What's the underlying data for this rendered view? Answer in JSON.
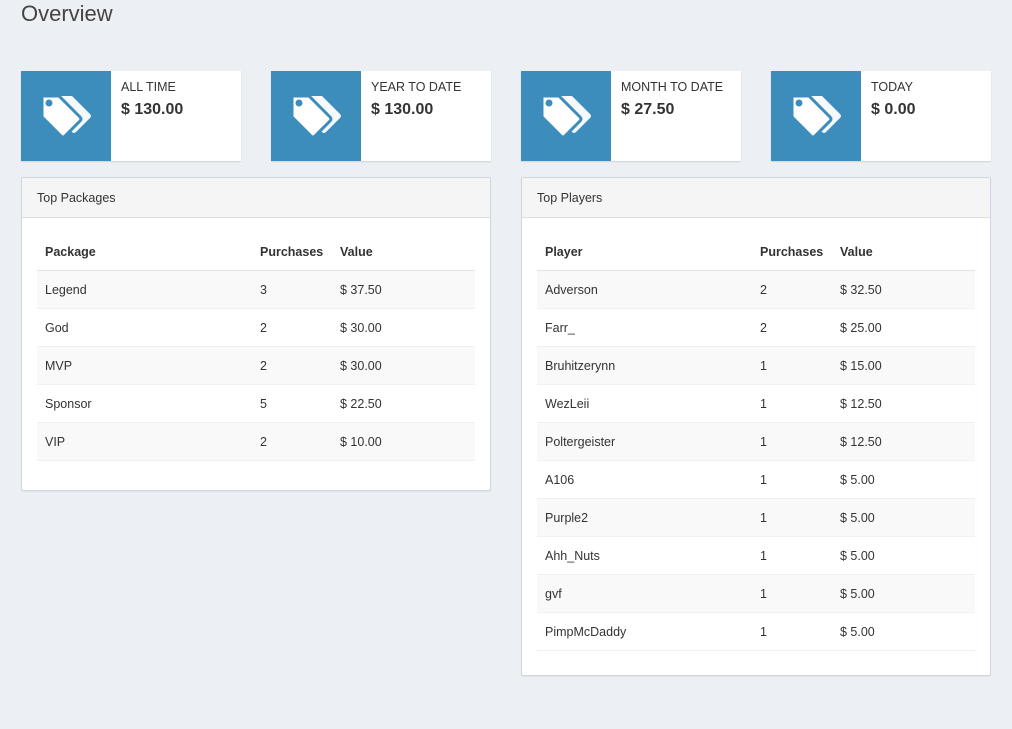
{
  "page": {
    "title": "Overview"
  },
  "colors": {
    "accent": "#3c8dbc",
    "background": "#ecf0f5"
  },
  "stats": [
    {
      "label": "ALL TIME",
      "value": "$ 130.00",
      "icon": "tags-icon"
    },
    {
      "label": "YEAR TO DATE",
      "value": "$ 130.00",
      "icon": "tags-icon"
    },
    {
      "label": "MONTH TO DATE",
      "value": "$ 27.50",
      "icon": "tags-icon"
    },
    {
      "label": "TODAY",
      "value": "$ 0.00",
      "icon": "tags-icon"
    }
  ],
  "top_packages": {
    "title": "Top Packages",
    "columns": [
      "Package",
      "Purchases",
      "Value"
    ],
    "rows": [
      [
        "Legend",
        "3",
        "$ 37.50"
      ],
      [
        "God",
        "2",
        "$ 30.00"
      ],
      [
        "MVP",
        "2",
        "$ 30.00"
      ],
      [
        "Sponsor",
        "5",
        "$ 22.50"
      ],
      [
        "VIP",
        "2",
        "$ 10.00"
      ]
    ]
  },
  "top_players": {
    "title": "Top Players",
    "columns": [
      "Player",
      "Purchases",
      "Value"
    ],
    "rows": [
      [
        "Adverson",
        "2",
        "$ 32.50"
      ],
      [
        "Farr_",
        "2",
        "$ 25.00"
      ],
      [
        "Bruhitzerynn",
        "1",
        "$ 15.00"
      ],
      [
        "WezLeii",
        "1",
        "$ 12.50"
      ],
      [
        "Poltergeister",
        "1",
        "$ 12.50"
      ],
      [
        "A106",
        "1",
        "$ 5.00"
      ],
      [
        "Purple2",
        "1",
        "$ 5.00"
      ],
      [
        "Ahh_Nuts",
        "1",
        "$ 5.00"
      ],
      [
        "gvf",
        "1",
        "$ 5.00"
      ],
      [
        "PimpMcDaddy",
        "1",
        "$ 5.00"
      ]
    ]
  }
}
